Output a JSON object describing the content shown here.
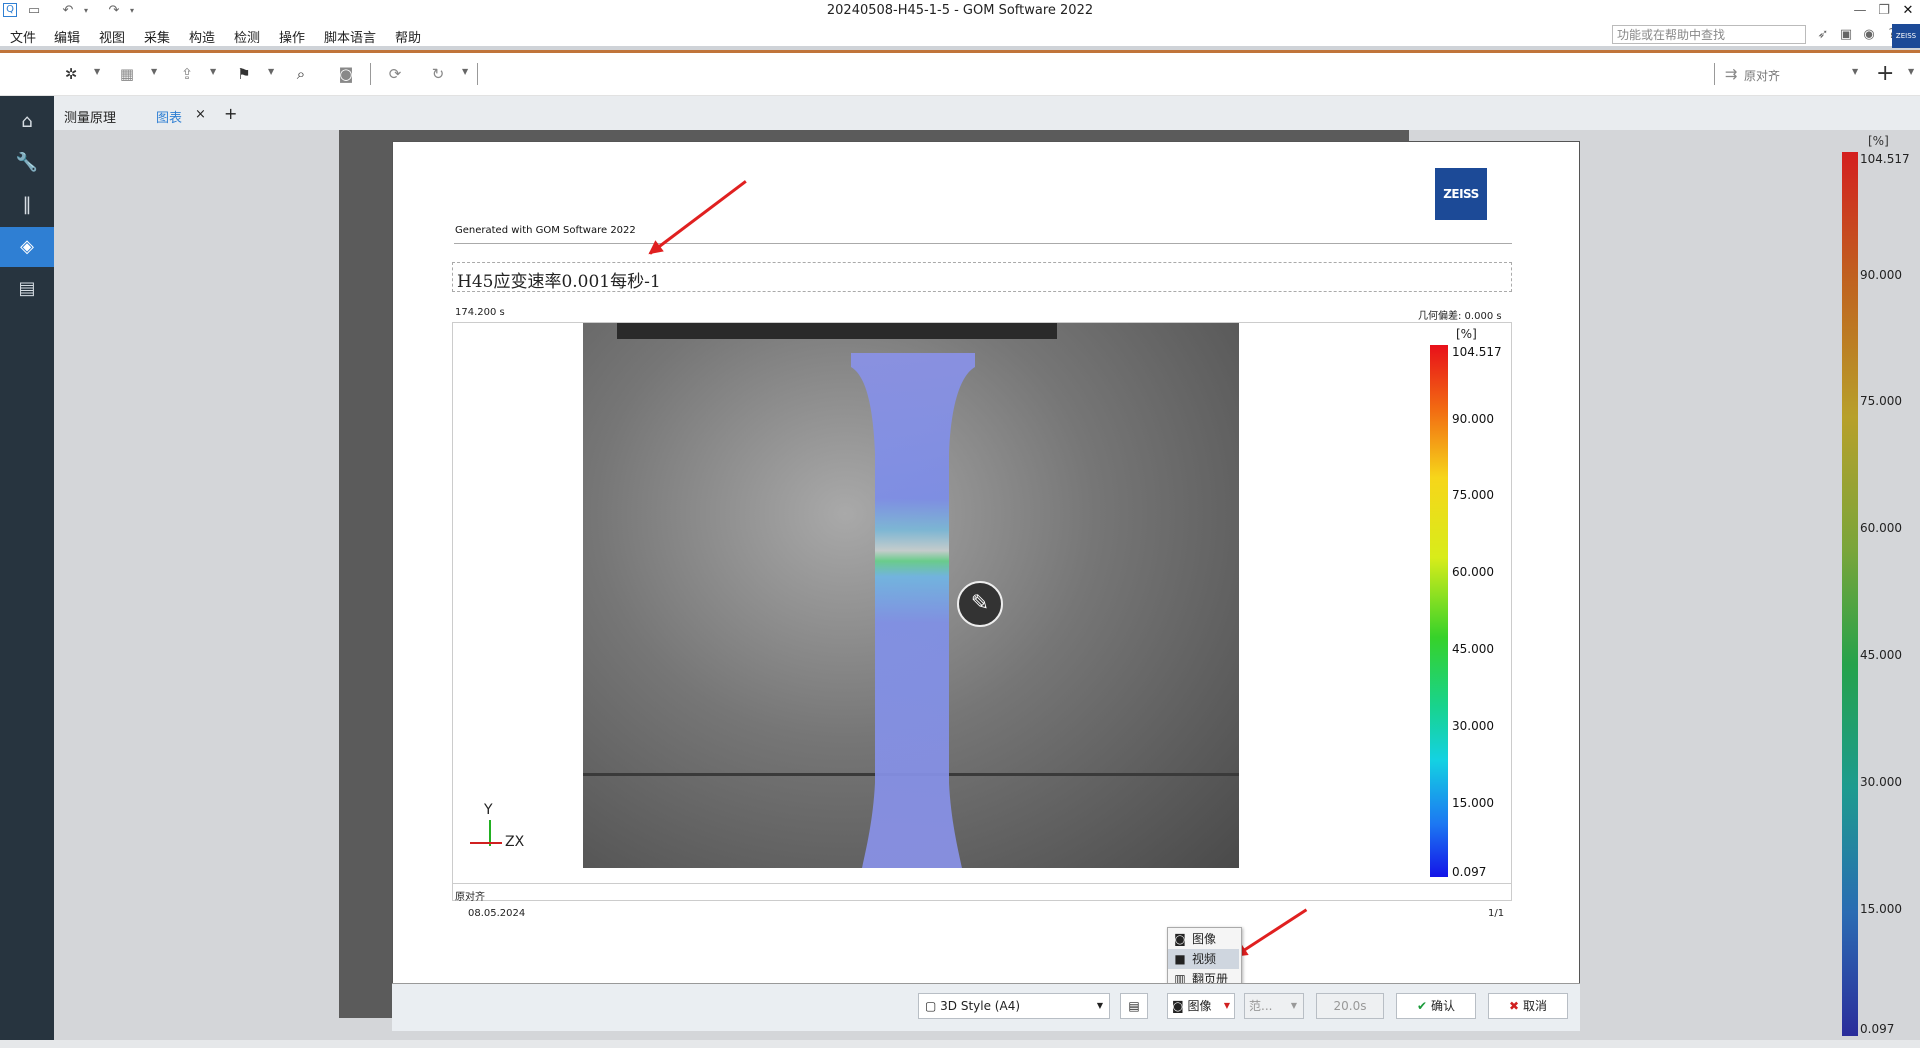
{
  "window": {
    "title": "20240508-H45-1-5 - GOM Software 2022"
  },
  "menu": [
    "文件",
    "编辑",
    "视图",
    "采集",
    "构造",
    "检测",
    "操作",
    "脚本语言",
    "帮助"
  ],
  "help_search": {
    "placeholder": "功能或在帮助中查找"
  },
  "toolbar": {
    "alignment": "原对齐"
  },
  "tabs": [
    {
      "label": "测量原理",
      "active": false
    },
    {
      "label": "图表",
      "active": true
    }
  ],
  "tab_add": "+",
  "tab_close": "×",
  "right_colorbar": {
    "unit": "[%]",
    "labels": [
      "104.517",
      "90.000",
      "75.000",
      "60.000",
      "45.000",
      "30.000",
      "15.000",
      "0.097"
    ]
  },
  "report": {
    "logo": "ZEISS",
    "generated": "Generated with GOM Software 2022",
    "title": "H45应变速率0.001每秒-1",
    "timestamp": "174.200 s",
    "deviation": "几何偏差: 0.000 s",
    "axis_y": "Y",
    "axis_zx": "ZX",
    "colorbar_unit": "[%]",
    "colorbar_labels": [
      "104.517",
      "90.000",
      "75.000",
      "60.000",
      "45.000",
      "30.000",
      "15.000",
      "0.097"
    ],
    "position_label": "原对齐",
    "date": "08.05.2024",
    "page": "1/1"
  },
  "dropdown": {
    "items": [
      {
        "label": "图像",
        "icon": "camera-icon",
        "highlighted": false
      },
      {
        "label": "视频",
        "icon": "video-icon",
        "highlighted": true
      },
      {
        "label": "翻页册",
        "icon": "flipbook-icon",
        "highlighted": false
      }
    ]
  },
  "footer": {
    "style_select": "3D Style (A4)",
    "capture_select": "图像",
    "range_select": "范...",
    "duration": "20.0s",
    "ok": "确认",
    "cancel": "取消"
  },
  "colors": {
    "accent": "#c0743a",
    "sidebar": "#27343f",
    "sidebar_active": "#2f7fd3",
    "zeiss_blue": "#1c4a97",
    "arrow_red": "#e02020"
  }
}
